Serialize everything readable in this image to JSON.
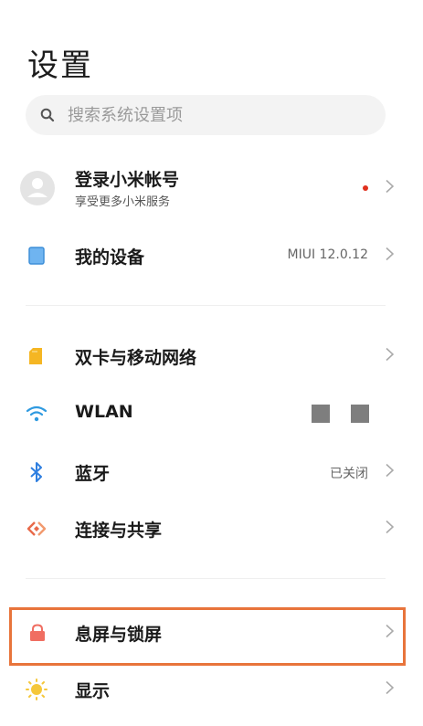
{
  "header": {
    "title": "设置"
  },
  "search": {
    "placeholder": "搜索系统设置项"
  },
  "account": {
    "label": "登录小米帐号",
    "sublabel": "享受更多小米服务"
  },
  "device": {
    "label": "我的设备",
    "value": "MIUI 12.0.12"
  },
  "network": {
    "sim": {
      "label": "双卡与移动网络"
    },
    "wlan": {
      "label": "WLAN"
    },
    "bluetooth": {
      "label": "蓝牙",
      "value": "已关闭"
    },
    "sharing": {
      "label": "连接与共享"
    }
  },
  "display_group": {
    "lockscreen": {
      "label": "息屏与锁屏"
    },
    "display": {
      "label": "显示"
    }
  },
  "colors": {
    "accent_highlight": "#e8743b",
    "notification_dot": "#e0301e",
    "device_icon": "#4a9ee8",
    "sim_icon": "#f5b623",
    "wlan_icon": "#2f9ae0",
    "bluetooth_icon": "#2f7fe0",
    "sharing_icon": "#e86a4a",
    "lock_icon": "#f06e62",
    "display_icon": "#f5c73a"
  }
}
